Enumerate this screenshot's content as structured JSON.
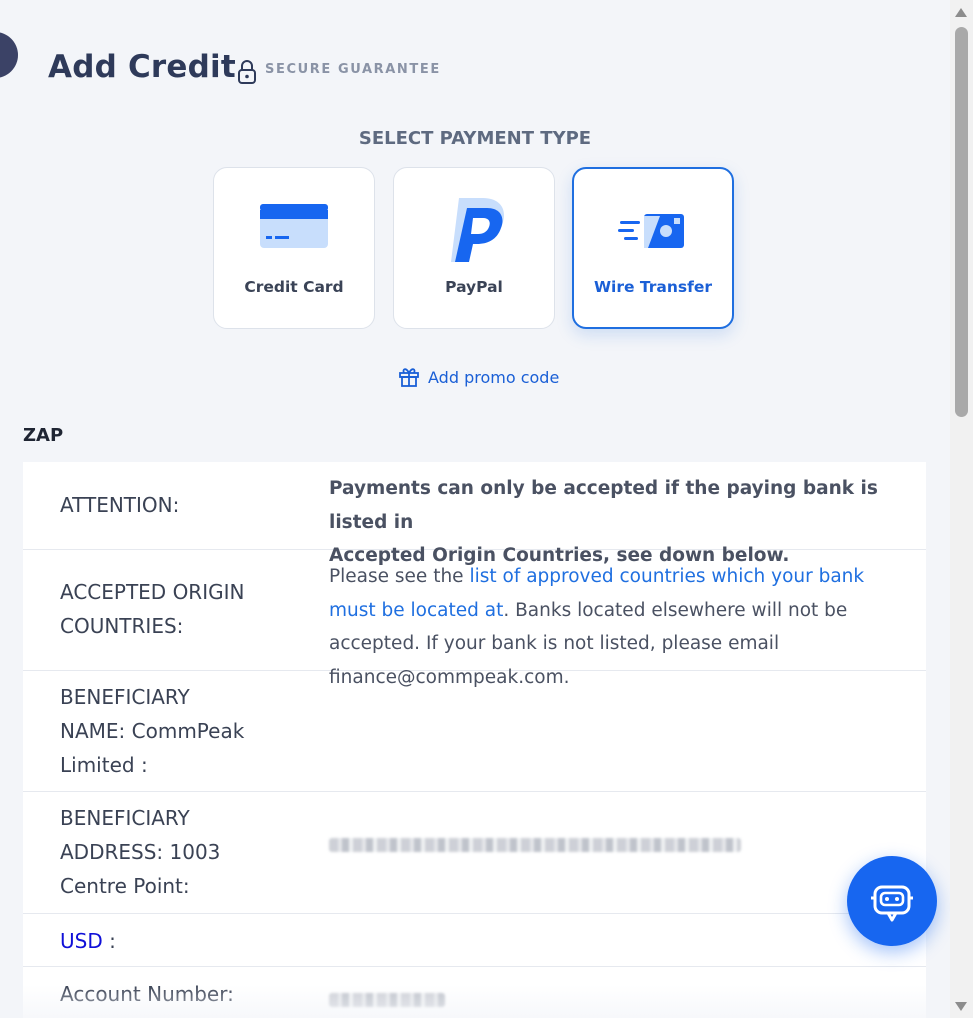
{
  "header": {
    "title": "Add Credit",
    "secure_label": "SECURE GUARANTEE"
  },
  "payment": {
    "select_label": "SELECT PAYMENT TYPE",
    "options": [
      {
        "label": "Credit Card",
        "icon": "credit-card-icon"
      },
      {
        "label": "PayPal",
        "icon": "paypal-icon"
      },
      {
        "label": "Wire Transfer",
        "icon": "wire-transfer-icon",
        "selected": true
      }
    ],
    "promo_label": "Add promo code"
  },
  "section": {
    "label": "ZAP",
    "rows": {
      "attention": {
        "key": "ATTENTION:",
        "value_line1": "Payments can only be accepted if the paying bank is listed in",
        "value_line2": "Accepted Origin Countries, see down below."
      },
      "countries": {
        "key_line1": "ACCEPTED ORIGIN",
        "key_line2": "COUNTRIES:",
        "pre": "Please see the ",
        "link": "list of approved countries which your bank must be located at",
        "post": ". Banks located elsewhere will not be accepted. If your bank is not listed, please email finance@commpeak.com."
      },
      "beneficiary_name": {
        "key_line1": "BENEFICIARY",
        "key_line2": "NAME: CommPeak",
        "key_line3": "Limited :"
      },
      "beneficiary_address": {
        "key_line1": "BENEFICIARY",
        "key_line2": "ADDRESS: 1003",
        "key_line3": "Centre Point:"
      },
      "usd": {
        "currency": "USD",
        "suffix": " :"
      },
      "account": {
        "key": "Account Number:"
      }
    }
  },
  "colors": {
    "accent": "#1f6fe0",
    "chat_button": "#1766f0"
  }
}
